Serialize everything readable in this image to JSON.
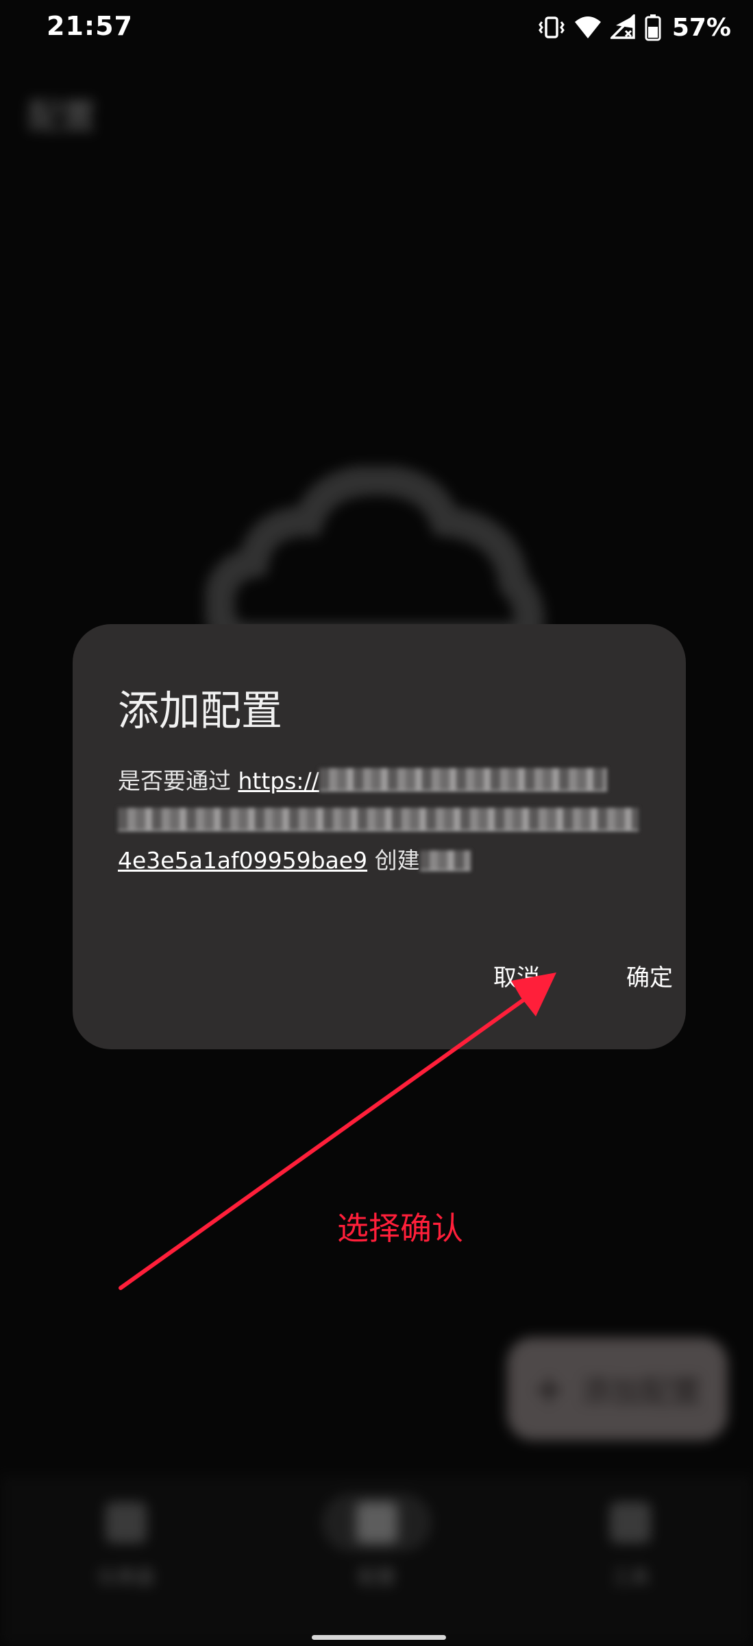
{
  "status_bar": {
    "time": "21:57",
    "battery_percent": "57%",
    "icons": [
      "vibrate-icon",
      "wifi-icon",
      "cellular-no-signal-icon",
      "battery-icon"
    ]
  },
  "background_app": {
    "title": "配置",
    "fab_label": "添加配置",
    "nav_items": [
      "仪表盘",
      "配置",
      "工具"
    ],
    "active_nav_index": 1
  },
  "dialog": {
    "title": "添加配置",
    "message_prefix": "是否要通过",
    "url_visible_start": "https://",
    "url_visible_end": "4e3e5a1af09959bae9",
    "message_suffix_visible": "创建",
    "cancel_label": "取消",
    "confirm_label": "确定"
  },
  "annotation": {
    "label": "选择确认",
    "color": "#ff1f3a"
  },
  "colors": {
    "dialog_bg": "#2f2d2d",
    "screen_bg": "#0c0c0c"
  }
}
